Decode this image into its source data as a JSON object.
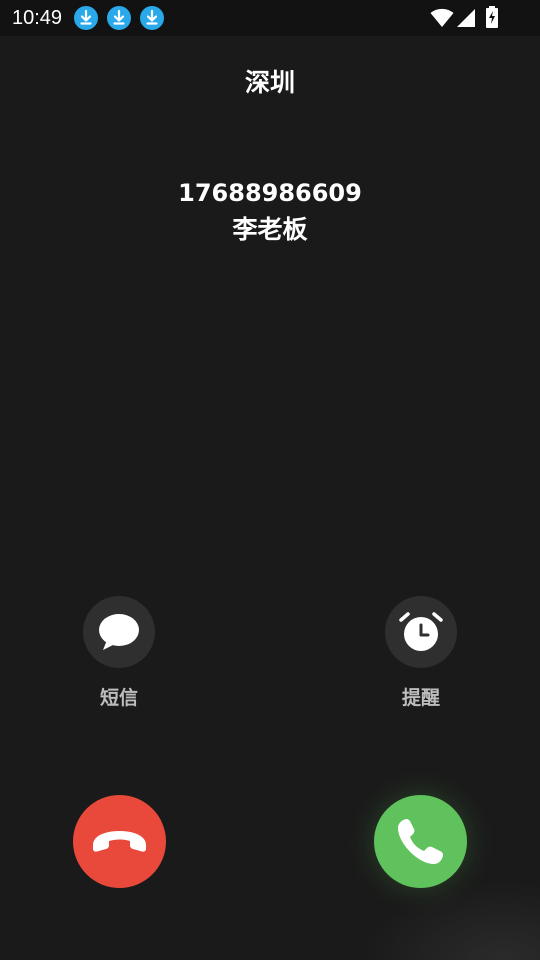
{
  "status_bar": {
    "time": "10:49",
    "notification_icons": [
      "download-icon",
      "download-icon",
      "download-icon"
    ],
    "right_icons": [
      "wifi-icon",
      "signal-icon",
      "battery-charging-icon"
    ]
  },
  "call": {
    "location": "深圳",
    "number": "17688986609",
    "contact_name": "李老板"
  },
  "actions": {
    "message_label": "短信",
    "reminder_label": "提醒"
  },
  "colors": {
    "background": "#1a1a1a",
    "decline": "#e8493a",
    "answer": "#5fc25c",
    "download_badge": "#29a9ea"
  }
}
